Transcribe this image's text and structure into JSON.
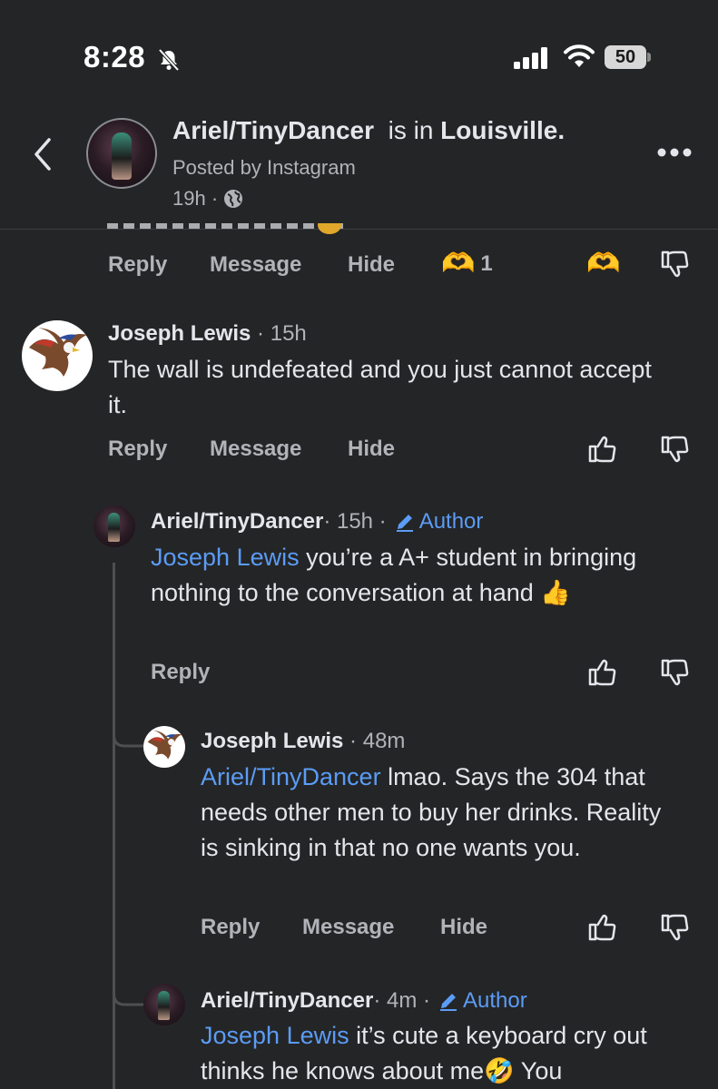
{
  "status_bar": {
    "time": "8:28",
    "battery": "50",
    "icons": [
      "bell-slash-icon",
      "signal-icon",
      "wifi-icon",
      "battery-icon"
    ]
  },
  "header": {
    "author_name": "Ariel/TinyDancer",
    "location_prefix": "is in",
    "location": "Louisville.",
    "posted_by": "Posted by Instagram",
    "time": "19h ·",
    "icons": [
      "back-icon",
      "globe-icon",
      "more-icon"
    ]
  },
  "top_actions": {
    "reply": "Reply",
    "message": "Message",
    "hide": "Hide",
    "reaction_count": "1",
    "reaction_emoji": "🫶",
    "reaction_button_emoji": "🫶"
  },
  "comments": [
    {
      "name": "Joseph Lewis",
      "meta": " · 15h",
      "text": "The wall is undefeated and you just cannot accept it.",
      "actions": {
        "reply": "Reply",
        "message": "Message",
        "hide": "Hide"
      }
    },
    {
      "name": "Ariel/TinyDancer",
      "meta": " · 15h ·",
      "badge": "Author",
      "mention": "Joseph Lewis",
      "text": " you’re a A+ student in bringing nothing to the conversation at hand 👍",
      "actions": {
        "reply": "Reply"
      }
    },
    {
      "name": "Joseph Lewis",
      "meta": " · 48m",
      "mention": "Ariel/TinyDancer",
      "text": "  lmao. Says the 304 that needs other men to buy her drinks. Reality is sinking in that no one wants you.",
      "actions": {
        "reply": "Reply",
        "message": "Message",
        "hide": "Hide"
      }
    },
    {
      "name": "Ariel/TinyDancer",
      "meta": " · 4m ·",
      "badge": "Author",
      "mention": "Joseph Lewis",
      "text": " it’s cute a keyboard cry out thinks he knows about me🤣  You"
    }
  ],
  "colors": {
    "background": "#242526",
    "text": "#e4e6eb",
    "muted": "#b0b3b8",
    "link": "#5b9cf6"
  }
}
